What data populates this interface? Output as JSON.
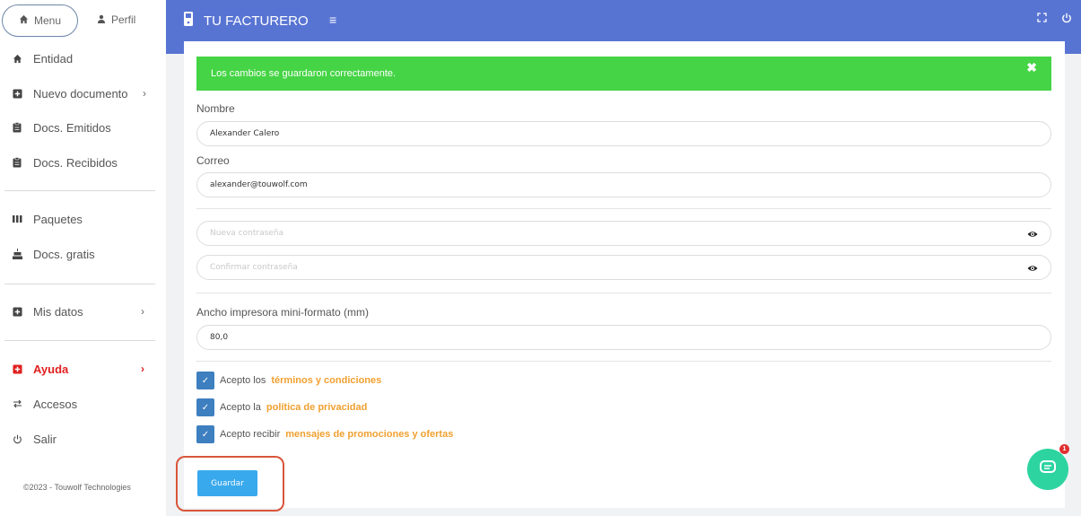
{
  "sidebar": {
    "menu_label": "Menu",
    "perfil_label": "Perfil",
    "items": [
      {
        "label": "Entidad",
        "icon": "home-icon"
      },
      {
        "label": "Nuevo documento",
        "icon": "plus-square-icon",
        "chevron": "›"
      },
      {
        "label": "Docs. Emitidos",
        "icon": "clipboard-icon"
      },
      {
        "label": "Docs. Recibidos",
        "icon": "clipboard-icon"
      },
      {
        "label": "Paquetes",
        "icon": "bars-icon"
      },
      {
        "label": "Docs. gratis",
        "icon": "cake-icon"
      },
      {
        "label": "Mis datos",
        "icon": "plus-square-icon",
        "chevron": "›"
      },
      {
        "label": "Ayuda",
        "icon": "plus-square-icon",
        "chevron": "›",
        "active": true,
        "color": "#e02020"
      },
      {
        "label": "Accesos",
        "icon": "swap-icon"
      },
      {
        "label": "Salir",
        "icon": "power-icon"
      }
    ],
    "copyright": "©2023 - Touwolf Technologies"
  },
  "topbar": {
    "title": "TU FACTURERO",
    "menu_icon": "≡",
    "right_icons": [
      "expand-icon",
      "power-icon"
    ],
    "color": "#5874d3"
  },
  "alert": {
    "message": "Los cambios se guardaron correctamente.",
    "close": "✖",
    "color": "#45d445"
  },
  "form": {
    "nombre_label": "Nombre",
    "nombre_value": "Alexander Calero",
    "correo_label": "Correo",
    "correo_value": "alexander@touwolf.com",
    "nueva_placeholder": "Nueva contraseña",
    "confirmar_placeholder": "Confirmar contraseña",
    "ancho_label": "Ancho impresora mini-formato (mm)",
    "ancho_value": "80,0",
    "checks": [
      {
        "prefix": "Acepto los",
        "link": "términos y condiciones",
        "checked": true
      },
      {
        "prefix": "Acepto la",
        "link": "política de privacidad",
        "checked": true
      },
      {
        "prefix": "Acepto recibir",
        "link": "mensajes de promociones y ofertas",
        "checked": true
      }
    ],
    "save_label": "Guardar"
  },
  "chat": {
    "badge": "1",
    "color": "#2dd4a0"
  }
}
